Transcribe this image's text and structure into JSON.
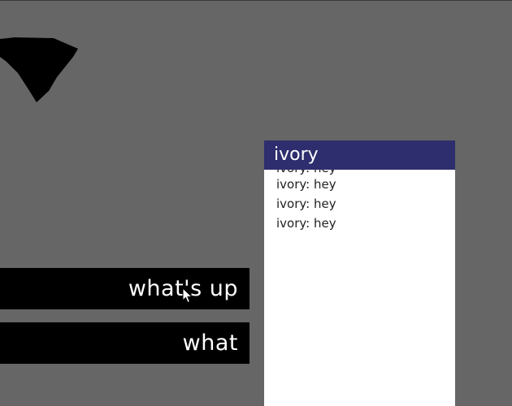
{
  "chat": {
    "title": "ivory",
    "messages": [
      {
        "speaker": "ivory",
        "text": "ivory: hey"
      },
      {
        "speaker": "ivory",
        "text": "ivory: hey"
      },
      {
        "speaker": "ivory",
        "text": "ivory: hey"
      },
      {
        "speaker": "ivory",
        "text": "ivory: hey"
      }
    ]
  },
  "replies": [
    {
      "label": "what's up"
    },
    {
      "label": "what"
    }
  ],
  "icons": {
    "blob": "black-blob-icon",
    "cursor": "mouse-cursor-icon"
  },
  "colors": {
    "background": "#666666",
    "header": "#2e2e6e",
    "panel": "#ffffff",
    "button": "#000000"
  }
}
